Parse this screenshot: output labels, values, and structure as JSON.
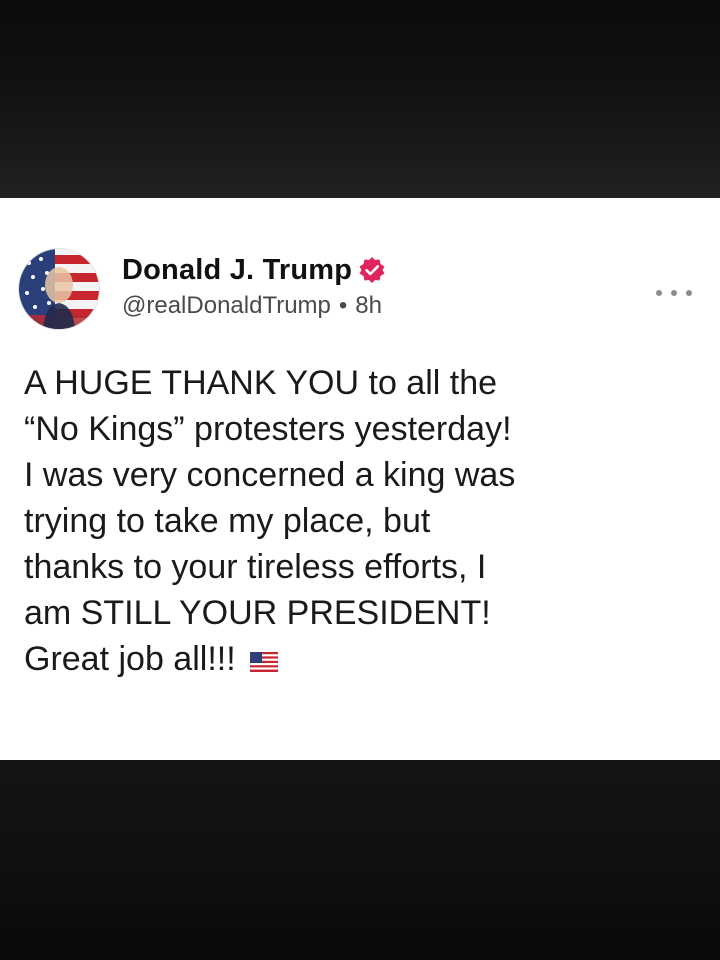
{
  "post": {
    "author": {
      "display_name": "Donald J. Trump",
      "handle": "@realDonaldTrump",
      "verified": true,
      "avatar_icon": "flag-portrait-avatar"
    },
    "timestamp": "8h",
    "separator": "•",
    "menu_icon": "more-options-icon",
    "body_lines": [
      "A HUGE THANK YOU to all the",
      "“No Kings” protesters yesterday!",
      "I was very concerned a king was",
      "trying to take my place, but",
      "thanks to your tireless efforts, I",
      "am STILL YOUR PRESIDENT!",
      "Great job all!!!"
    ],
    "trailing_emoji": "us-flag-emoji"
  },
  "colors": {
    "verified_badge": "#e0245e",
    "card_background": "#ffffff",
    "frame_background": "#0c0c0c",
    "handle_text": "#4a4a4a"
  }
}
